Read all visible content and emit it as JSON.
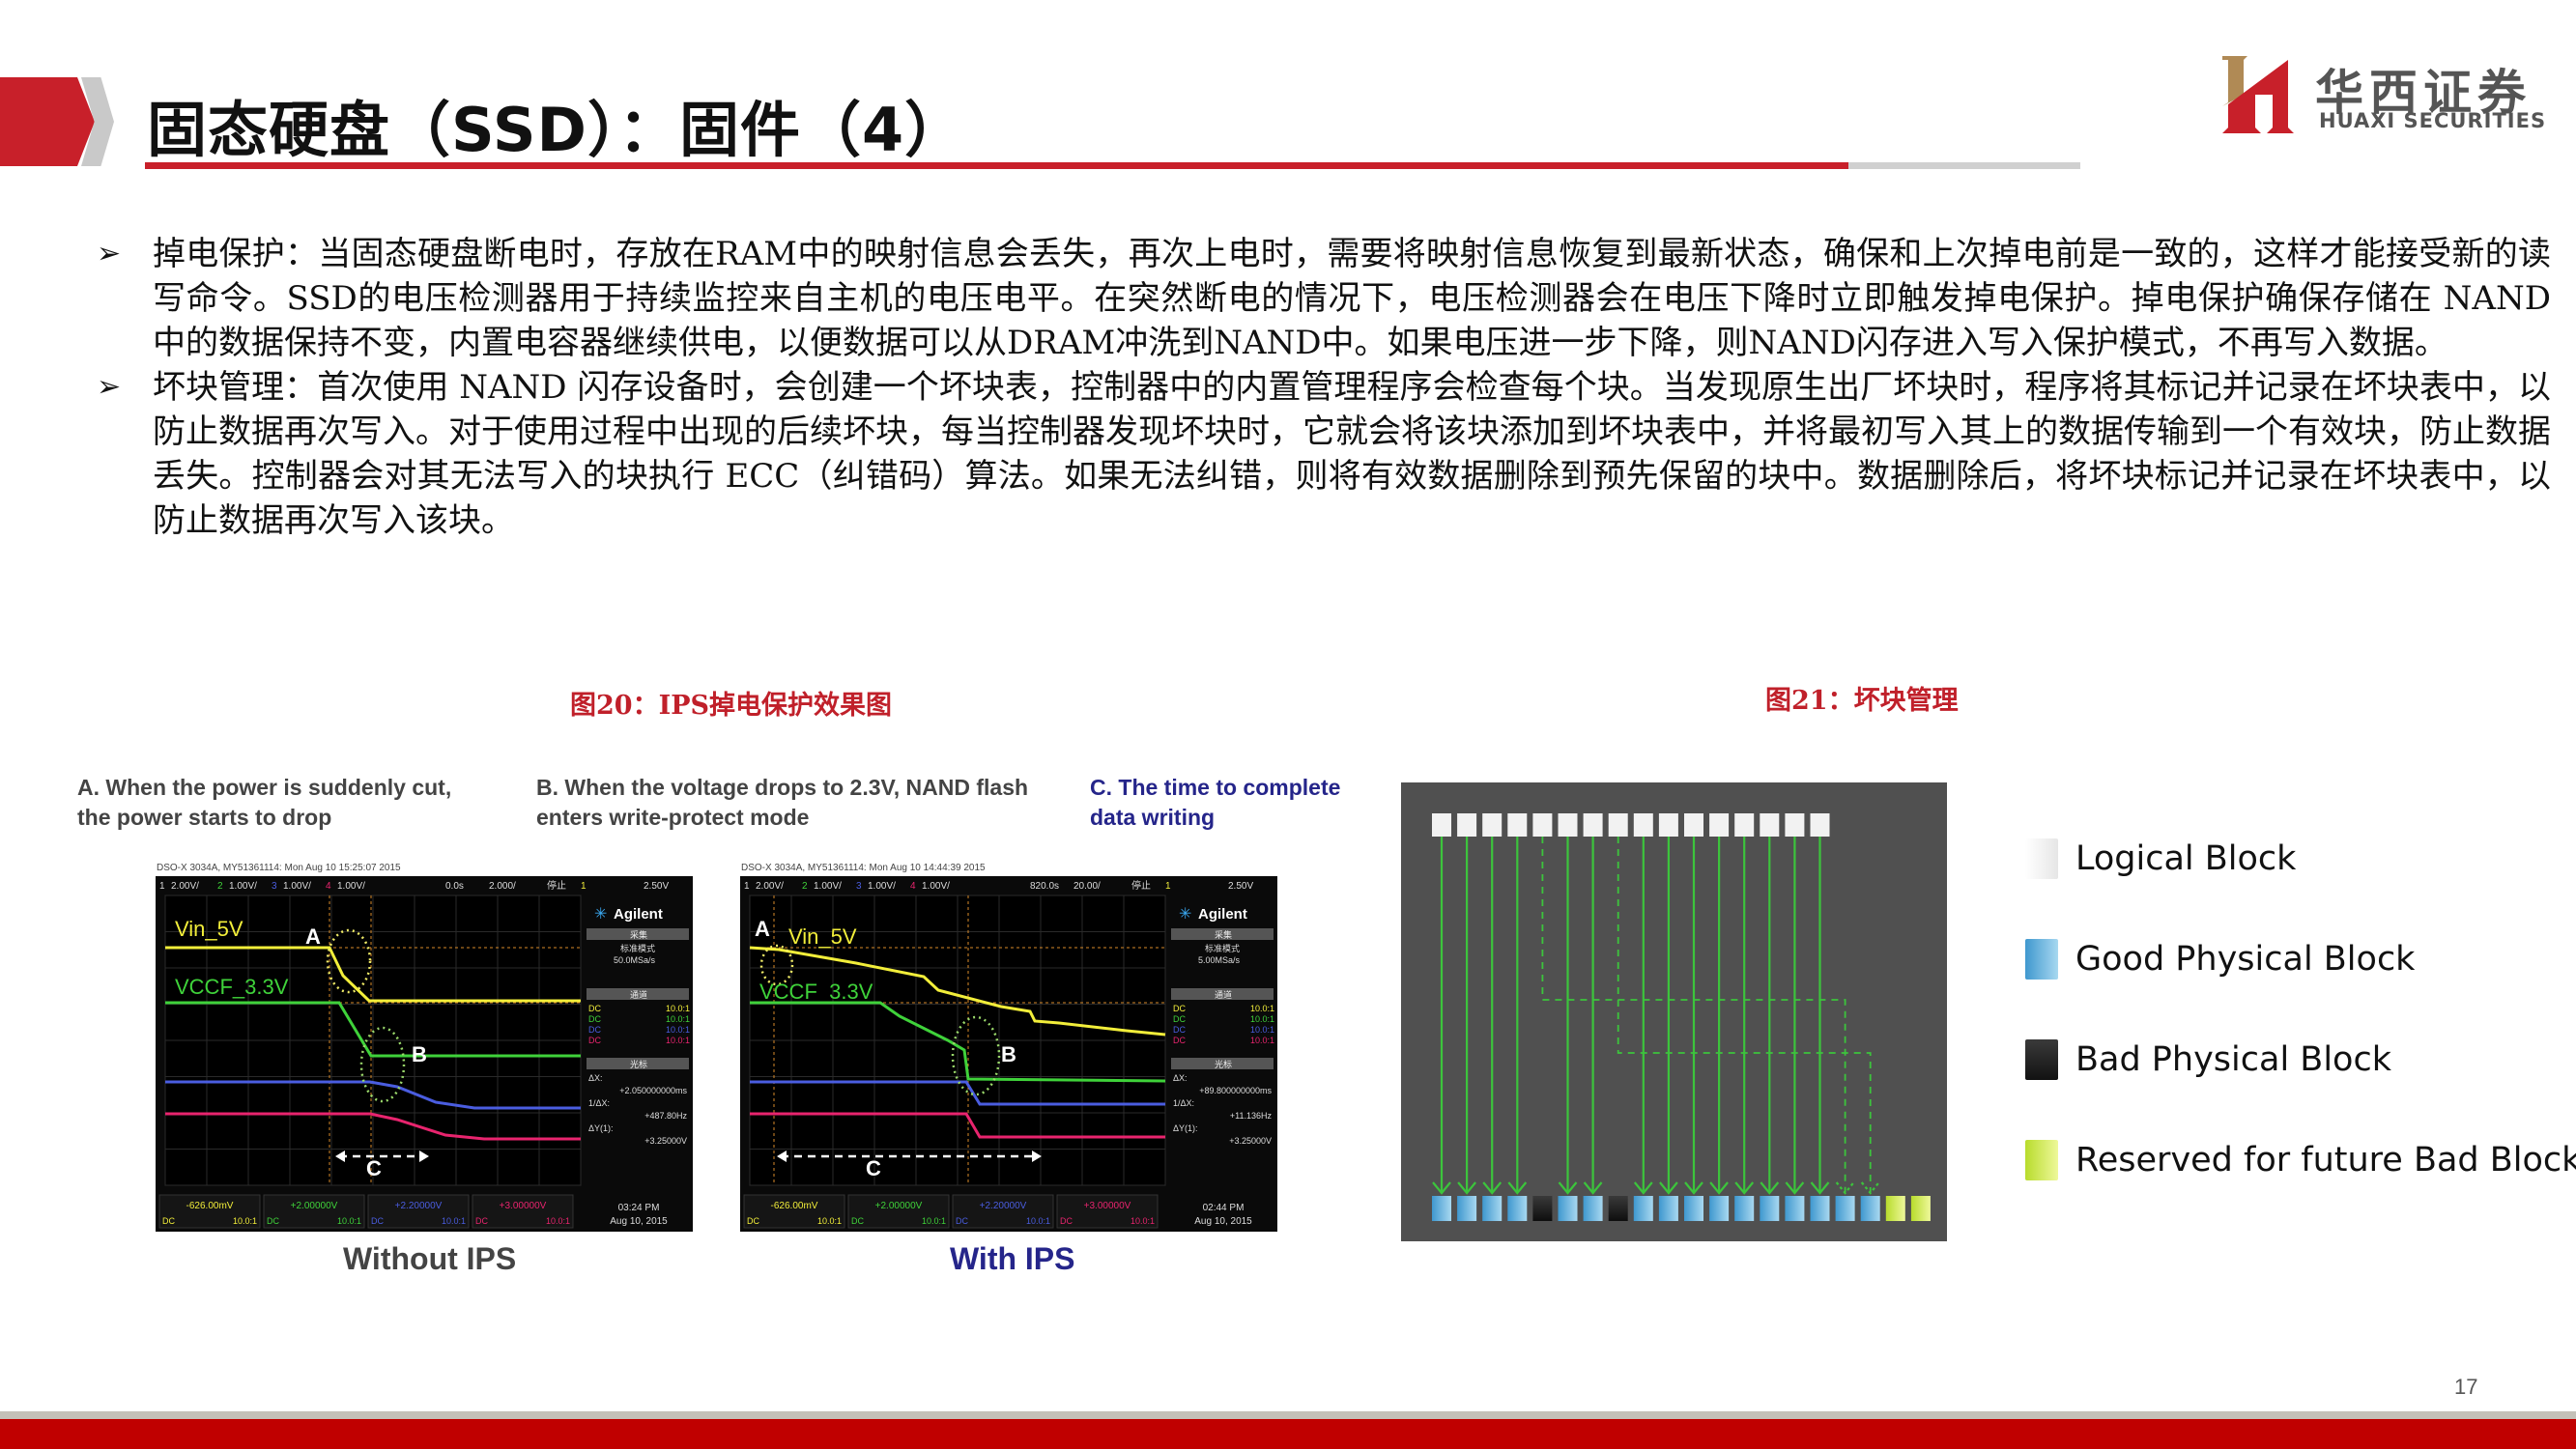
{
  "header": {
    "title": "固态硬盘（SSD）：固件（4）"
  },
  "logo": {
    "name_cn": "华西证券",
    "name_en": "HUAXI SECURITIES",
    "colors": {
      "red": "#c8202a",
      "gold": "#b08a55"
    }
  },
  "bullets": [
    {
      "icon": "arrow-bullet-icon",
      "text": "掉电保护：当固态硬盘断电时，存放在RAM中的映射信息会丢失，再次上电时，需要将映射信息恢复到最新状态，确保和上次掉电前是一致的，这样才能接受新的读写命令。SSD的电压检测器用于持续监控来自主机的电压电平。在突然断电的情况下，电压检测器会在电压下降时立即触发掉电保护。掉电保护确保存储在 NAND 中的数据保持不变，内置电容器继续供电，以便数据可以从DRAM冲洗到NAND中。如果电压进一步下降，则NAND闪存进入写入保护模式，不再写入数据。"
    },
    {
      "icon": "arrow-bullet-icon",
      "text": "坏块管理：首次使用 NAND 闪存设备时，会创建一个坏块表，控制器中的内置管理程序会检查每个块。当发现原生出厂坏块时，程序将其标记并记录在坏块表中，以防止数据再次写入。对于使用过程中出现的后续坏块，每当控制器发现坏块时，它就会将该块添加到坏块表中，并将最初写入其上的数据传输到一个有效块，防止数据丢失。控制器会对其无法写入的块执行 ECC（纠错码）算法。如果无法纠错，则将有效数据删除到预先保留的块中。数据删除后，将坏块标记并记录在坏块表中，以防止数据再次写入该块。"
    }
  ],
  "figure20": {
    "caption": "图20：IPS掉电保护效果图",
    "notes": {
      "a": "A. When the power is suddenly cut, the power starts to drop",
      "b": "B. When the voltage drops to 2.3V, NAND flash enters write-protect mode",
      "c": "C. The time to complete data writing"
    },
    "scopes": [
      {
        "subtitle": "Without IPS",
        "header_line": "DSO-X 3034A, MY51361114: Mon Aug 10 15:25:07 2015",
        "top_bar": [
          "1",
          "2.00V/",
          "2",
          "1.00V/",
          "3",
          "1.00V/",
          "4",
          "1.00V/",
          "0.0s",
          "2.000/",
          "停止",
          "1",
          "2.50V"
        ],
        "brand": "Agilent",
        "mode_label": "采集",
        "mode": "标准模式",
        "sample_rate": "50.0MSa/s",
        "channel_section": "通道",
        "channels": [
          "DC 10.0:1",
          "DC 10.0:1",
          "DC 10.0:1",
          "DC 10.0:1"
        ],
        "cursor_section": "光标",
        "delta_x_label": "ΔX:",
        "delta_x": "+2.050000000ms",
        "inv_delta_x_label": "1/ΔX:",
        "inv_delta_x": "+487.80Hz",
        "delta_y_label": "ΔY(1):",
        "delta_y": "+3.25000V",
        "bottom": [
          "-626.00mV",
          "+2.00000V",
          "+2.20000V",
          "+3.00000V"
        ],
        "bottom_sub": [
          "DC",
          "10.0:1"
        ],
        "time": "03:24 PM",
        "date": "Aug 10, 2015",
        "labels": {
          "vin": "Vin_5V",
          "vccf": "VCCF_3.3V",
          "a": "A",
          "b": "B",
          "c": "C"
        }
      },
      {
        "subtitle": "With IPS",
        "header_line": "DSO-X 3034A, MY51361114: Mon Aug 10 14:44:39 2015",
        "top_bar": [
          "1",
          "2.00V/",
          "2",
          "1.00V/",
          "3",
          "1.00V/",
          "4",
          "1.00V/",
          "820.0s",
          "20.00/",
          "停止",
          "1",
          "2.50V"
        ],
        "brand": "Agilent",
        "mode_label": "采集",
        "mode": "标准模式",
        "sample_rate": "5.00MSa/s",
        "channel_section": "通道",
        "channels": [
          "DC 10.0:1",
          "DC 10.0:1",
          "DC 10.0:1",
          "DC 10.0:1"
        ],
        "cursor_section": "光标",
        "delta_x_label": "ΔX:",
        "delta_x": "+89.800000000ms",
        "inv_delta_x_label": "1/ΔX:",
        "inv_delta_x": "+11.136Hz",
        "delta_y_label": "ΔY(1):",
        "delta_y": "+3.25000V",
        "bottom": [
          "-626.00mV",
          "+2.00000V",
          "+2.20000V",
          "+3.00000V"
        ],
        "bottom_sub": [
          "DC",
          "10.0:1"
        ],
        "time": "02:44 PM",
        "date": "Aug 10, 2015",
        "labels": {
          "vin": "Vin_5V",
          "vccf": "VCCF_3.3V",
          "a": "A",
          "b": "B",
          "c": "C"
        }
      }
    ],
    "trace_colors": {
      "ch1": "#f2ee3a",
      "ch2": "#3fd23a",
      "ch3": "#4a5de0",
      "ch4": "#e8246e"
    }
  },
  "figure21": {
    "caption": "图21：坏块管理",
    "logical_blocks": 16,
    "physical_blocks": [
      "good",
      "good",
      "good",
      "good",
      "bad",
      "good",
      "good",
      "bad",
      "good",
      "good",
      "good",
      "good",
      "good",
      "good",
      "good",
      "good",
      "good",
      "good",
      "reserved",
      "reserved"
    ],
    "legend": [
      {
        "label": "Logical Block",
        "kind": "logical",
        "color": "#f2f2f2"
      },
      {
        "label": "Good Physical Block",
        "kind": "good",
        "color": "#5aaed8"
      },
      {
        "label": "Bad Physical Block",
        "kind": "bad",
        "color": "#1e1e1e"
      },
      {
        "label": "Reserved for future Bad Block",
        "kind": "reserved",
        "color": "#d4ef5a"
      }
    ],
    "arrow_color": "#3cc43c"
  },
  "footer": {
    "page_number": "17"
  }
}
